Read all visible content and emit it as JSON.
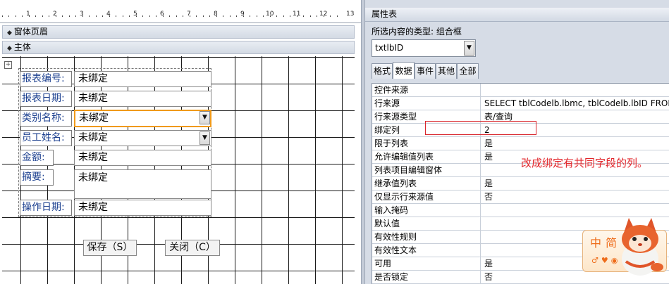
{
  "designer": {
    "ruler_numbers": [
      "1",
      "2",
      "3",
      "4",
      "5",
      "6",
      "7",
      "8",
      "9",
      "10",
      "11",
      "12",
      "13"
    ],
    "sections": {
      "header": "窗体页眉",
      "detail": "主体"
    },
    "fields": [
      {
        "label": "报表编号:",
        "value": "未绑定",
        "type": "text"
      },
      {
        "label": "报表日期:",
        "value": "未绑定",
        "type": "text"
      },
      {
        "label": "类别名称:",
        "value": "未绑定",
        "type": "combo",
        "selected": true
      },
      {
        "label": "员工姓名:",
        "value": "未绑定",
        "type": "combo"
      },
      {
        "label": "金额:",
        "value": "未绑定",
        "type": "text"
      },
      {
        "label": "摘要:",
        "value": "未绑定",
        "type": "memo"
      },
      {
        "label": "操作日期:",
        "value": "未绑定",
        "type": "text"
      }
    ],
    "buttons": {
      "save": "保存（S）",
      "close": "关闭（C）"
    }
  },
  "property_sheet": {
    "title": "属性表",
    "selection_type": "所选内容的类型: 组合框",
    "object_name": "txtlbID",
    "tabs": [
      "格式",
      "数据",
      "事件",
      "其他",
      "全部"
    ],
    "active_tab": "数据",
    "rows": [
      {
        "name": "控件来源",
        "value": ""
      },
      {
        "name": "行来源",
        "value": "SELECT tblCodelb.lbmc, tblCodelb.lbID FROM"
      },
      {
        "name": "行来源类型",
        "value": "表/查询"
      },
      {
        "name": "绑定列",
        "value": "2"
      },
      {
        "name": "限于列表",
        "value": "是"
      },
      {
        "name": "允许编辑值列表",
        "value": "是"
      },
      {
        "name": "列表项目编辑窗体",
        "value": ""
      },
      {
        "name": "继承值列表",
        "value": "是"
      },
      {
        "name": "仅显示行来源值",
        "value": "否"
      },
      {
        "name": "输入掩码",
        "value": ""
      },
      {
        "name": "默认值",
        "value": ""
      },
      {
        "name": "有效性规则",
        "value": ""
      },
      {
        "name": "有效性文本",
        "value": ""
      },
      {
        "name": "可用",
        "value": "是"
      },
      {
        "name": "是否锁定",
        "value": "否"
      }
    ]
  },
  "annotation": "改成绑定有共同字段的列。",
  "ime": {
    "text": "中简",
    "icons": "♂♥◉"
  },
  "colors": {
    "label_text": "#1b3f8f",
    "selection_border": "#f09a1a",
    "annotation_red": "#e2262b"
  }
}
